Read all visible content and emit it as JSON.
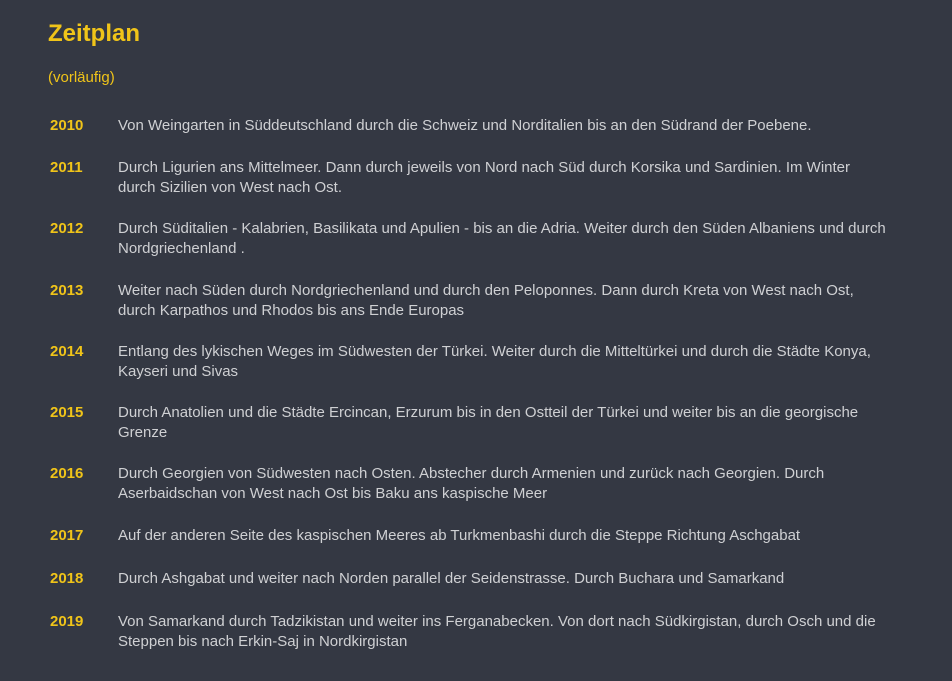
{
  "header": {
    "title": "Zeitplan",
    "subtitle": "(vorläufig)"
  },
  "schedule": [
    {
      "year": "2010",
      "text": "Von Weingarten in Süddeutschland durch die Schweiz und Norditalien bis an den Südrand der Poebene."
    },
    {
      "year": "2011",
      "text": "Durch Ligurien ans Mittelmeer. Dann durch jeweils von Nord nach Süd durch Korsika und Sardinien. Im Winter durch Sizilien von West nach Ost."
    },
    {
      "year": "2012",
      "text": "Durch Süditalien - Kalabrien, Basilikata und Apulien - bis an die Adria. Weiter durch den Süden Albaniens und durch Nordgriechenland ."
    },
    {
      "year": "2013",
      "text": "Weiter nach Süden durch Nordgriechenland und durch den Peloponnes. Dann durch Kreta von West nach Ost, durch Karpathos und Rhodos bis ans Ende Europas"
    },
    {
      "year": "2014",
      "text": "Entlang des lykischen Weges im Südwesten der Türkei. Weiter durch die Mitteltürkei und durch die Städte Konya, Kayseri und Sivas"
    },
    {
      "year": "2015",
      "text": "Durch Anatolien und die Städte Ercincan, Erzurum bis in den Ostteil der Türkei und weiter bis an die georgische Grenze"
    },
    {
      "year": "2016",
      "text": "Durch Georgien von Südwesten nach Osten. Abstecher durch Armenien und zurück nach Georgien. Durch Aserbaidschan von West nach Ost bis Baku ans kaspische Meer"
    },
    {
      "year": "2017",
      "text": "Auf der anderen Seite des kaspischen Meeres ab Turkmenbashi durch die Steppe Richtung Aschgabat"
    },
    {
      "year": "2018",
      "text": "Durch Ashgabat und weiter nach Norden parallel der Seidenstrasse. Durch Buchara und Samarkand"
    },
    {
      "year": "2019",
      "text": "Von Samarkand durch Tadzikistan und weiter ins Ferganabecken. Von dort nach Südkirgistan, durch Osch und die Steppen bis nach Erkin-Saj in Nordkirgistan"
    }
  ],
  "colors": {
    "background": "#343843",
    "accent": "#f0c419",
    "text": "#cfd0d3"
  }
}
